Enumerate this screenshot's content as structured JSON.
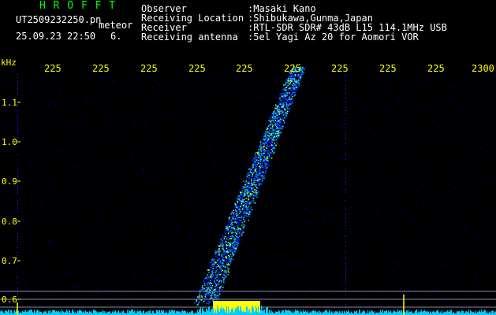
{
  "logo": "H R O F F T",
  "file_name": "UT2509232250.pn",
  "meteor_label": "meteor",
  "date_time": "25.09.23 22:50",
  "count": "6.",
  "info": [
    {
      "key": "Observer",
      "value": ":Masaki Kano"
    },
    {
      "key": "Receiving Location",
      "value": ":Shibukawa,Gunma,Japan"
    },
    {
      "key": "Receiver",
      "value": ":RTL-SDR SDR# 43dB L15 114.1MHz USB"
    },
    {
      "key": "Receiving antenna",
      "value": ":5el Yagi Az 20 for Aomori VOR"
    }
  ],
  "y_unit": "kHz",
  "x_ticks": [
    "225",
    "225",
    "225",
    "225",
    "225",
    "225",
    "225",
    "225",
    "225",
    "2300"
  ],
  "y_ticks": [
    "1.1",
    "1.0",
    "0.9",
    "0.8",
    "0.7",
    "0.6"
  ],
  "colors": {
    "text": "#ffffff",
    "ticks": "#ffff00",
    "logo": "#00ff00",
    "signal_low": "#0000aa",
    "signal_high": "#00ffff",
    "carrier": "#ffff00"
  }
}
